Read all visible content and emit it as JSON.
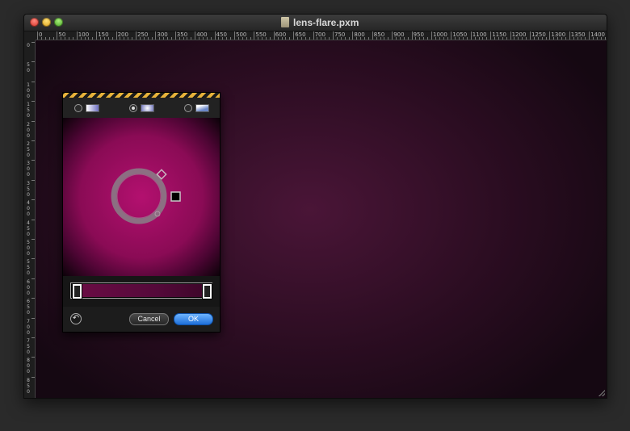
{
  "window": {
    "title": "lens-flare.pxm"
  },
  "ruler": {
    "horizontal_labels": [
      "0",
      "50",
      "100",
      "150",
      "200",
      "250",
      "300",
      "350",
      "400",
      "450",
      "500",
      "550",
      "600",
      "650",
      "700",
      "750",
      "800",
      "850",
      "900",
      "950",
      "1000",
      "1050",
      "1100",
      "1150",
      "1200",
      "1250",
      "1300",
      "1350",
      "1400"
    ],
    "vertical_labels": [
      "0",
      "50",
      "100",
      "150",
      "200",
      "250",
      "300",
      "350",
      "400",
      "450",
      "500",
      "550",
      "600",
      "650",
      "700",
      "750",
      "800",
      "850"
    ]
  },
  "gradient_panel": {
    "types": [
      {
        "name": "linear",
        "selected": false
      },
      {
        "name": "radial",
        "selected": true
      },
      {
        "name": "angle",
        "selected": false
      }
    ],
    "preview_colors": [
      "#b3106f",
      "#0b0208"
    ],
    "stop_colors": [
      "#6b0c45",
      "#3a0627"
    ],
    "reset_icon": "↶",
    "cancel_label": "Cancel",
    "ok_label": "OK"
  }
}
